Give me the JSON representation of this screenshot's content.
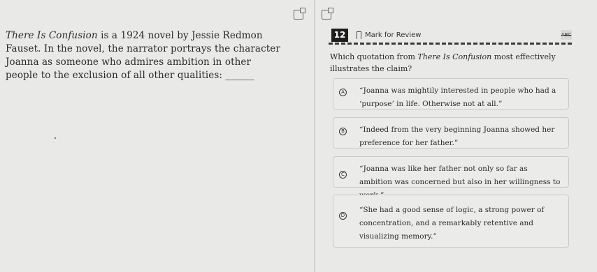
{
  "passage": {
    "title": "There Is Confusion",
    "text_after_title": " is a 1924 novel by Jessie Redmon Fauset. In the novel, the narrator portrays the character Joanna as someone who admires ambition in other people to the exclusion of all other qualities: ",
    "blank": "______"
  },
  "question": {
    "number": "12",
    "mark_label": "Mark for Review",
    "abc_label": "ABC",
    "prompt_before": "Which quotation from ",
    "prompt_title": "There Is Confusion",
    "prompt_after": " most effectively illustrates the claim?"
  },
  "options": [
    {
      "letter": "A",
      "text": "“Joanna was mightily interested in people who had a ‘purpose’ in life. Otherwise not at all.”"
    },
    {
      "letter": "B",
      "text": "“Indeed from the very beginning Joanna showed her preference for her father.”"
    },
    {
      "letter": "C",
      "text": "“Joanna was like her father not only so far as ambition was concerned but also in her willingness to work.”"
    },
    {
      "letter": "D",
      "text": "“She had a good sense of logic, a strong power of concentration, and a remarkably retentive and visualizing memory.”"
    }
  ]
}
